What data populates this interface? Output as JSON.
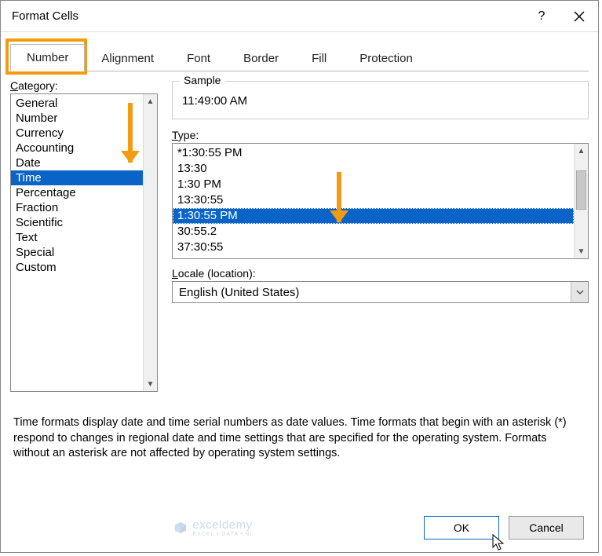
{
  "window": {
    "title": "Format Cells",
    "help_name": "help-button",
    "close_name": "close-button"
  },
  "tabs": [
    {
      "label": "Number",
      "active": true
    },
    {
      "label": "Alignment",
      "active": false
    },
    {
      "label": "Font",
      "active": false
    },
    {
      "label": "Border",
      "active": false
    },
    {
      "label": "Fill",
      "active": false
    },
    {
      "label": "Protection",
      "active": false
    }
  ],
  "category": {
    "label_pre": "C",
    "label_rest": "ategory:",
    "items": [
      "General",
      "Number",
      "Currency",
      "Accounting",
      "Date",
      "Time",
      "Percentage",
      "Fraction",
      "Scientific",
      "Text",
      "Special",
      "Custom"
    ],
    "selected_index": 5
  },
  "sample": {
    "group_title": "Sample",
    "value": "11:49:00 AM"
  },
  "type": {
    "label_pre": "T",
    "label_rest": "ype:",
    "items": [
      "*1:30:55 PM",
      "13:30",
      "1:30 PM",
      "13:30:55",
      "1:30:55 PM",
      "30:55.2",
      "37:30:55"
    ],
    "selected_index": 4
  },
  "locale": {
    "label_pre": "L",
    "label_rest": "ocale (location):",
    "value": "English (United States)"
  },
  "description": "Time formats display date and time serial numbers as date values.  Time formats that begin with an asterisk (*) respond to changes in regional date and time settings that are specified for the operating system. Formats without an asterisk are not affected by operating system settings.",
  "buttons": {
    "ok": "OK",
    "cancel": "Cancel"
  },
  "watermark": {
    "brand": "exceldemy",
    "sub": "EXCEL • DATA • BI"
  },
  "colors": {
    "highlight": "#F39C12",
    "selection": "#0a64c8"
  }
}
